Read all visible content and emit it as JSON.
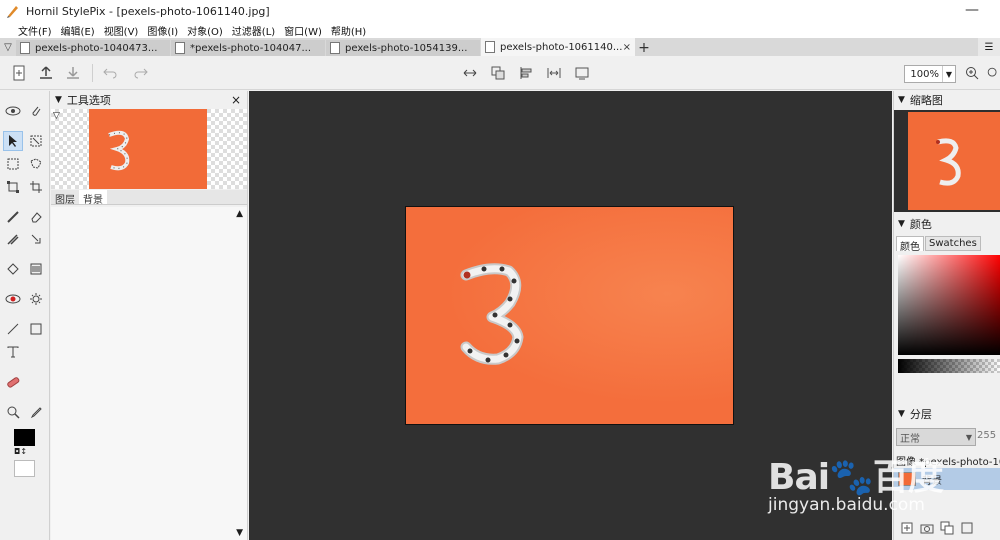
{
  "window": {
    "title": "Hornil StylePix - [pexels-photo-1061140.jpg]",
    "minimize": "—"
  },
  "menu": [
    {
      "label": "文件(F)"
    },
    {
      "label": "编辑(E)"
    },
    {
      "label": "视图(V)"
    },
    {
      "label": "图像(I)"
    },
    {
      "label": "对象(O)"
    },
    {
      "label": "过滤器(L)"
    },
    {
      "label": "窗口(W)"
    },
    {
      "label": "帮助(H)"
    }
  ],
  "tabs": [
    {
      "label": "pexels-photo-1040473...",
      "active": false
    },
    {
      "label": "*pexels-photo-104047...",
      "active": false
    },
    {
      "label": "pexels-photo-1054139...",
      "active": false
    },
    {
      "label": "pexels-photo-1061140...",
      "active": true
    }
  ],
  "tab_close": "×",
  "tab_add": "+",
  "toolbar": {
    "zoom": "100%"
  },
  "tool_options": {
    "title": "工具选项",
    "close": "×",
    "subtabs": [
      "图层",
      "背景"
    ]
  },
  "thumbnail": {
    "title": "缩略图"
  },
  "color": {
    "title": "颜色",
    "tabs": [
      "颜色",
      "Swatches"
    ]
  },
  "layers": {
    "title": "分层",
    "blend_mode": "正常",
    "opacity": "255",
    "document": "图像 *pexels-photo-106",
    "layer_name": "背景"
  },
  "watermark": {
    "brand": "Bai🐾百度",
    "url": "jingyan.baidu.com",
    "badge": "经验"
  },
  "colors": {
    "canvas_bg": "#303030",
    "image_orange": "#f46e3c",
    "selection": "#cce0f5"
  }
}
